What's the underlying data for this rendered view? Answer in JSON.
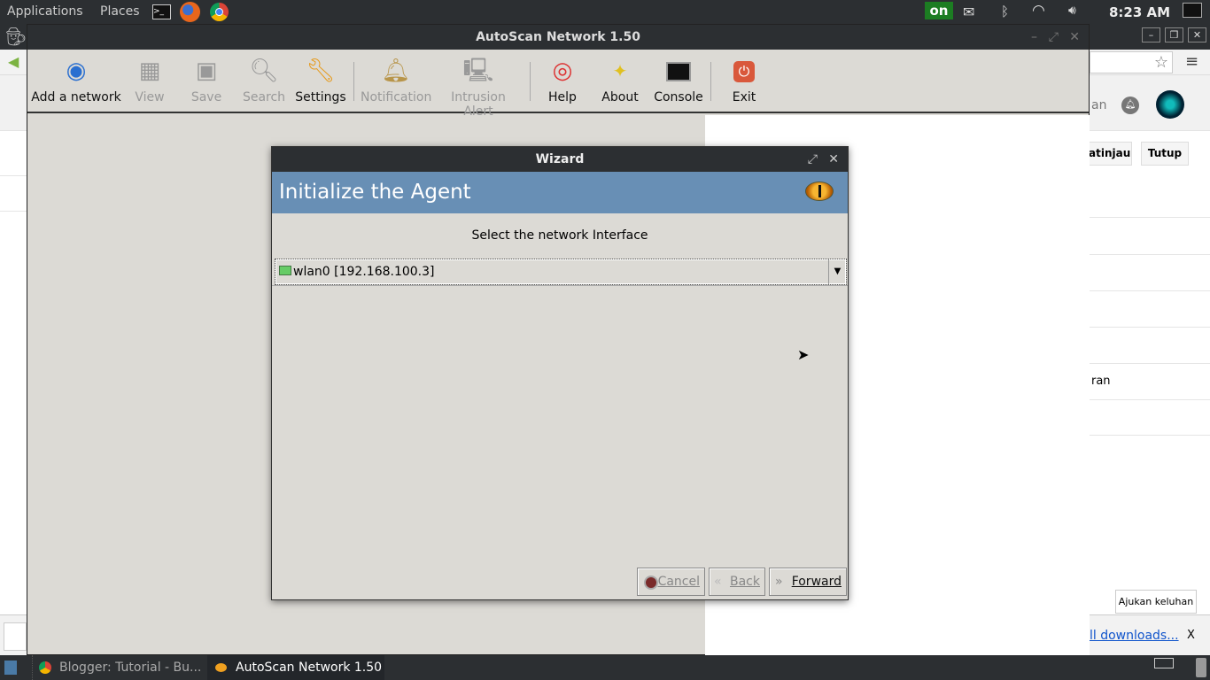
{
  "top_panel": {
    "applications": "Applications",
    "places": "Places",
    "clock": "8:23 AM",
    "indicator_on": "on",
    "icons": [
      "terminal-icon",
      "firefox-icon",
      "chrome-icon",
      "mail-icon",
      "bluetooth-icon",
      "wifi-icon",
      "volume-icon",
      "display-icon"
    ]
  },
  "browser": {
    "header_partial": "an",
    "button_partial": "atinjau",
    "button_close": "Tutup",
    "list_partial": "ran",
    "complaint_button": "Ajukan keluhan",
    "downloads_link": "ll downloads...",
    "downloads_close": "X"
  },
  "autoscan": {
    "title": "AutoScan Network 1.50",
    "toolbar": [
      {
        "label": "Add a network",
        "enabled": true
      },
      {
        "label": "View",
        "enabled": false
      },
      {
        "label": "Save",
        "enabled": false
      },
      {
        "label": "Search",
        "enabled": false
      },
      {
        "label": "Settings",
        "enabled": true
      },
      {
        "label": "Notification",
        "enabled": false
      },
      {
        "label": "Intrusion Alert",
        "enabled": false
      },
      {
        "label": "Help",
        "enabled": true
      },
      {
        "label": "About",
        "enabled": true
      },
      {
        "label": "Console",
        "enabled": true
      },
      {
        "label": "Exit",
        "enabled": true
      }
    ]
  },
  "wizard": {
    "title": "Wizard",
    "heading": "Initialize the Agent",
    "prompt": "Select the network Interface",
    "interface_selected": "wlan0 [192.168.100.3]",
    "buttons": {
      "cancel": "Cancel",
      "back": "Back",
      "forward": "Forward"
    },
    "header_color": "#688fb5"
  },
  "taskbar": {
    "items": [
      {
        "label": "Blogger: Tutorial - Bu...",
        "active": false
      },
      {
        "label": "AutoScan Network 1.50",
        "active": true
      }
    ]
  }
}
